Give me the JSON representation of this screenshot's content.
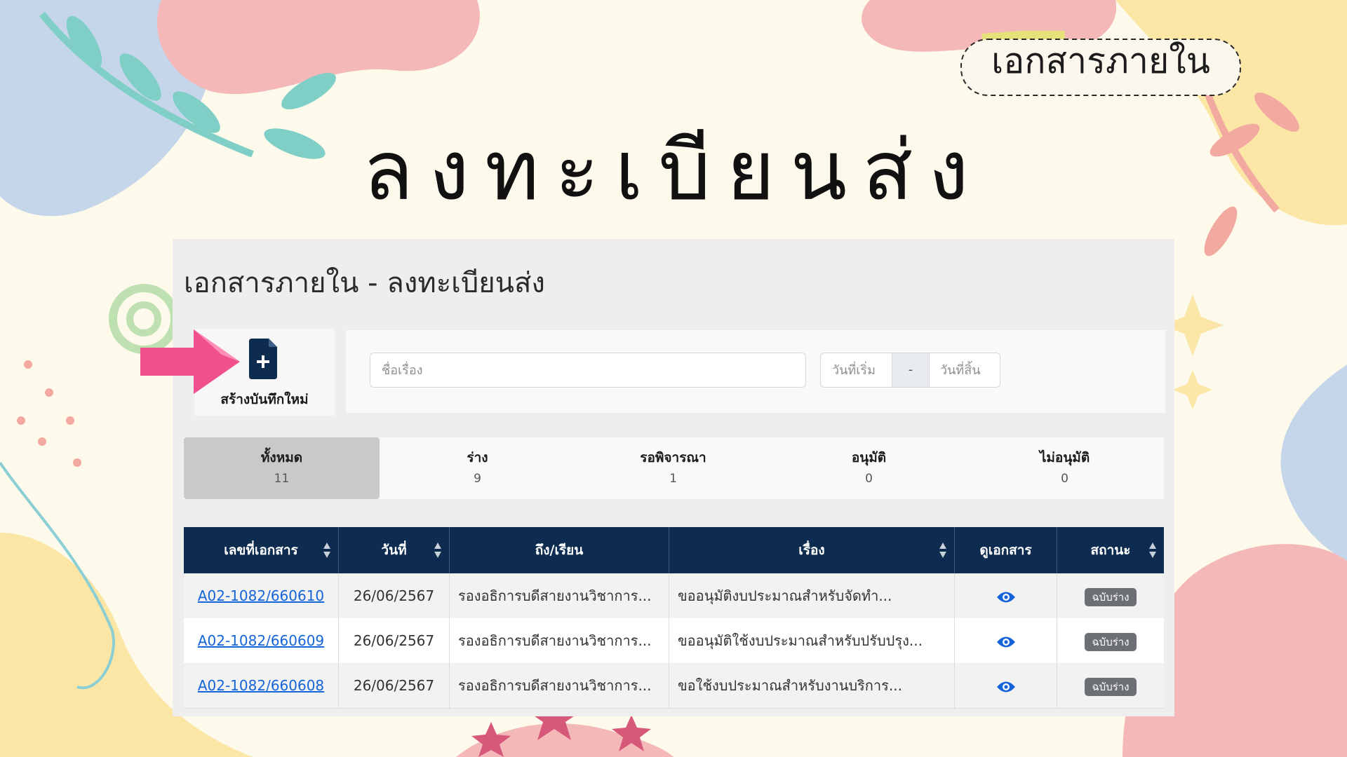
{
  "sticker": {
    "label": "เอกสารภายใน"
  },
  "slide_title": "ลงทะเบียนส่ง",
  "page": {
    "title": "เอกสารภายใน - ลงทะเบียนส่ง"
  },
  "new_record": {
    "label": "สร้างบันทึกใหม่",
    "icon": "file-plus-icon"
  },
  "filters": {
    "subject_placeholder": "ชื่อเรื่อง",
    "date_start_placeholder": "วันที่เริ่ม",
    "date_separator": "-",
    "date_end_placeholder": "วันที่สิ้น",
    "search_icon": "search-icon",
    "clear_icon": "trash-icon"
  },
  "tabs": [
    {
      "label": "ทั้งหมด",
      "count": "11",
      "active": true
    },
    {
      "label": "ร่าง",
      "count": "9"
    },
    {
      "label": "รอพิจารณา",
      "count": "1"
    },
    {
      "label": "อนุมัติ",
      "count": "0"
    },
    {
      "label": "ไม่อนุมัติ",
      "count": "0"
    }
  ],
  "table": {
    "headers": [
      "เลขที่เอกสาร",
      "วันที่",
      "ถึง/เรียน",
      "เรื่อง",
      "ดูเอกสาร",
      "สถานะ"
    ],
    "rows": [
      {
        "doc_no": "A02-1082/660610",
        "date": "26/06/2567",
        "to": "รองอธิการบดีสายงานวิชาการ...",
        "subject": "ขออนุมัติงบประมาณสำหรับจัดทำ...",
        "status": "ฉบับร่าง"
      },
      {
        "doc_no": "A02-1082/660609",
        "date": "26/06/2567",
        "to": "รองอธิการบดีสายงานวิชาการ...",
        "subject": "ขออนุมัติใช้งบประมาณสำหรับปรับปรุง...",
        "status": "ฉบับร่าง"
      },
      {
        "doc_no": "A02-1082/660608",
        "date": "26/06/2567",
        "to": "รองอธิการบดีสายงานวิชาการ...",
        "subject": "ขอใช้งบประมาณสำหรับงานบริการ...",
        "status": "ฉบับร่าง"
      }
    ]
  },
  "colors": {
    "navy": "#0d2c4f",
    "link": "#1565d8",
    "badge": "#6c6f73",
    "arrow": "#f0508c"
  }
}
